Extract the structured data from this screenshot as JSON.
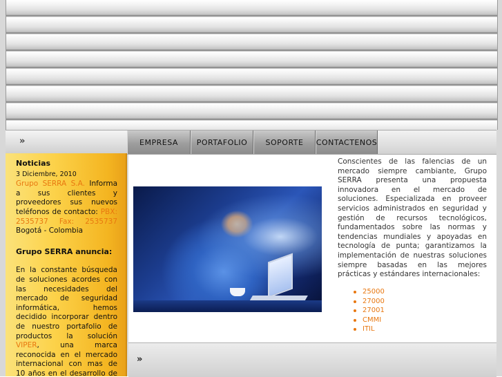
{
  "nav": {
    "left_arrows": "»",
    "tabs": [
      {
        "label": "EMPRESA"
      },
      {
        "label": "PORTAFOLIO"
      },
      {
        "label": "SOPORTE"
      },
      {
        "label": "CONTACTENOS"
      }
    ]
  },
  "sidebar": {
    "title": "Noticias",
    "date": "3 Diciembre, 2010",
    "news_company": "Grupo SERRA S.A.",
    "news_text": "Informa a sus clientes y proveedores sus nuevos teléfonos de contacto:",
    "news_phones": "PBX: 2535737 Fax: 2535737",
    "news_city": "Bogotá - Colombia",
    "announce_title": "Grupo SERRA  anuncia:",
    "announce_text_1": "En la constante búsqueda de soluciones acordes con las necesidades del mercado de seguridad informática, hemos decidido incorporar dentro de nuestro portafolio de productos la solución",
    "announce_link": "VIPER",
    "announce_text_2": ", una marca reconocida en el mercado internacional con mas de 10 años en el desarrollo de productos"
  },
  "main": {
    "description": "Conscientes de las falencias de un mercado siempre cambiante, Grupo SERRA presenta una propuesta innovadora en el mercado de soluciones. Especializada en proveer servicios administrados en seguridad y gestión de recursos tecnológicos, fundamentados sobre las normas y tendencias mundiales y apoyadas en tecnología de punta; garantizamos la implementación de nuestras soluciones siempre basadas en las mejores prácticas y estándares internacionales:",
    "standards": [
      "25000",
      "27000",
      "27001",
      "CMMI",
      "ITIL"
    ]
  },
  "footer": {
    "arrows": "»"
  },
  "colors": {
    "accent_orange": "#e8770f",
    "sidebar_yellow": "#fcd24a"
  }
}
